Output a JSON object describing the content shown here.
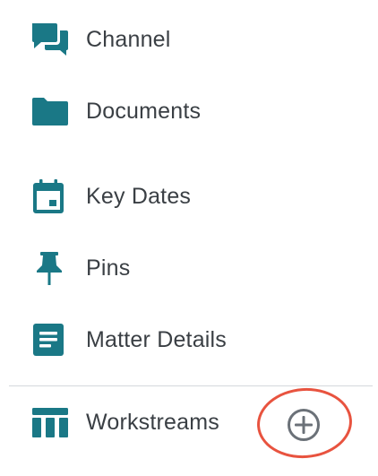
{
  "theme": {
    "icon_color": "#1a7886",
    "label_color": "#3a3f44",
    "highlight_color": "#e8533f",
    "add_icon_color": "#6b7178"
  },
  "menu": {
    "items": [
      {
        "label": "Channel",
        "icon": "chat-icon"
      },
      {
        "label": "Documents",
        "icon": "folder-icon"
      },
      {
        "label": "Key Dates",
        "icon": "calendar-icon"
      },
      {
        "label": "Pins",
        "icon": "pin-icon"
      },
      {
        "label": "Matter Details",
        "icon": "document-icon"
      },
      {
        "label": "Workstreams",
        "icon": "table-icon"
      }
    ],
    "add_button": {
      "icon": "plus-circle-icon"
    }
  }
}
